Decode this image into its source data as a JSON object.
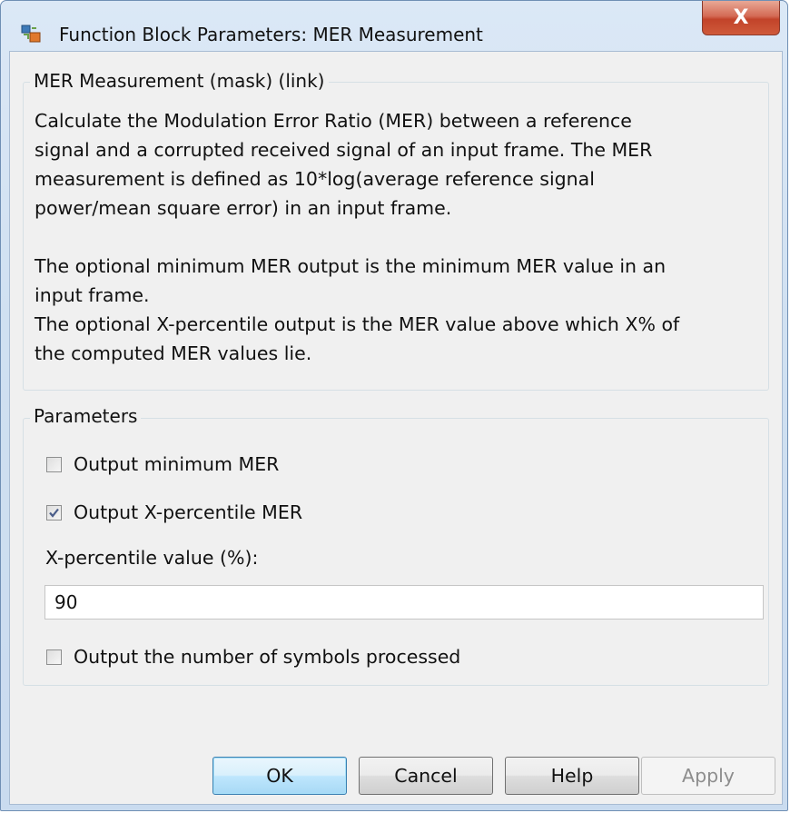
{
  "window": {
    "title": "Function Block Parameters: MER Measurement",
    "close_glyph": "X"
  },
  "description": {
    "legend": "MER Measurement (mask) (link)",
    "lines": [
      "Calculate the Modulation Error Ratio (MER) between a reference",
      "signal and a corrupted received signal of an input frame. The MER",
      "measurement is defined as 10*log(average reference signal",
      "power/mean square error) in an input frame.",
      "",
      "The optional minimum MER output is the minimum MER value in an",
      "input frame.",
      "The optional X-percentile output is the MER value above which X% of",
      "the computed MER values lie."
    ]
  },
  "parameters": {
    "legend": "Parameters",
    "output_minimum_mer": {
      "label": "Output minimum MER",
      "checked": false
    },
    "output_x_percentile_mer": {
      "label": "Output X-percentile MER",
      "checked": true
    },
    "x_percentile_value": {
      "label": "X-percentile value (%):",
      "value": "90"
    },
    "output_num_symbols": {
      "label": "Output the number of symbols processed",
      "checked": false
    }
  },
  "buttons": {
    "ok": "OK",
    "cancel": "Cancel",
    "help": "Help",
    "apply": "Apply"
  },
  "icons": {
    "app": "simulink-block-icon",
    "close": "close-icon",
    "check": "checkmark-icon"
  }
}
